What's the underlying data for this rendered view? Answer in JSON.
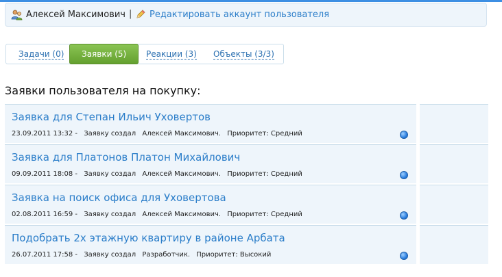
{
  "user": {
    "name": "Алексей Максимович",
    "separator": "|",
    "edit_link": "Редактировать аккаунт пользователя"
  },
  "tabs": [
    {
      "label": "Задачи (0)",
      "active": false
    },
    {
      "label": "Заявки (5)",
      "active": true
    },
    {
      "label": "Реакции (3)",
      "active": false
    },
    {
      "label": "Объекты (3/3)",
      "active": false
    }
  ],
  "section_title": "Заявки пользователя на покупку:",
  "requests": [
    {
      "title": "Заявка для Степан Ильич Уховертов",
      "date": "23.09.2011 13:32 -",
      "action": "Заявку создал",
      "author": "Алексей Максимович.",
      "priority": "Приоритет: Средний"
    },
    {
      "title": "Заявка для Платонов Платон Михайлович",
      "date": "09.09.2011 18:08 -",
      "action": "Заявку создал",
      "author": "Алексей Максимович.",
      "priority": "Приоритет: Средний"
    },
    {
      "title": "Заявка на поиск офиса для Уховертова",
      "date": "02.08.2011 16:59 -",
      "action": "Заявку создал",
      "author": "Алексей Максимович.",
      "priority": "Приоритет: Средний"
    },
    {
      "title": "Подобрать 2х этажную квартиру в районе Арбата",
      "date": "26.07.2011 17:58 -",
      "action": "Заявку создал",
      "author": "Разработчик.",
      "priority": "Приоритет: Высокий"
    }
  ],
  "colors": {
    "accent_blue": "#2a7dc9",
    "active_tab_green": "#6fa83a",
    "row_background": "#eef5fb"
  },
  "icons": {
    "user": "users-icon",
    "edit": "pencil-icon",
    "status": "status-dot-icon"
  }
}
